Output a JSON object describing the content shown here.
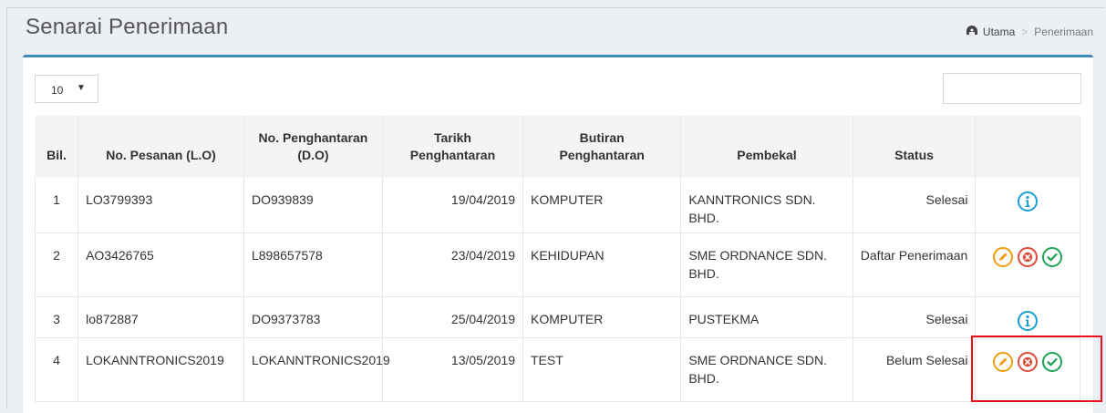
{
  "page": {
    "title": "Senarai Penerimaan"
  },
  "breadcrumb": {
    "home": "Utama",
    "current": "Penerimaan"
  },
  "controls": {
    "page_length": "10",
    "search_value": ""
  },
  "table": {
    "headers": {
      "bil": "Bil.",
      "pesanan": "No. Pesanan (L.O)",
      "penghantaran_1": "No. Penghantaran",
      "penghantaran_2": "(D.O)",
      "tarikh_1": "Tarikh",
      "tarikh_2": "Penghantaran",
      "butiran_1": "Butiran",
      "butiran_2": "Penghantaran",
      "pembekal": "Pembekal",
      "status": "Status"
    },
    "rows": [
      {
        "bil": "1",
        "lo": "LO3799393",
        "do": "DO939839",
        "tarikh": "19/04/2019",
        "butiran": "KOMPUTER",
        "pembekal": "KANNTRONICS SDN. BHD.",
        "status": "Selesai",
        "actions": [
          "info"
        ]
      },
      {
        "bil": "2",
        "lo": "AO3426765",
        "do": "L898657578",
        "tarikh": "23/04/2019",
        "butiran": "KEHIDUPAN",
        "pembekal": "SME ORDNANCE SDN. BHD.",
        "status": "Daftar Penerimaan",
        "actions": [
          "edit",
          "delete",
          "approve"
        ]
      },
      {
        "bil": "3",
        "lo": "lo872887",
        "do": "DO9373783",
        "tarikh": "25/04/2019",
        "butiran": "KOMPUTER",
        "pembekal": "PUSTEKMA",
        "status": "Selesai",
        "actions": [
          "info"
        ]
      },
      {
        "bil": "4",
        "lo": "LOKANNTRONICS2019",
        "do": "LOKANNTRONICS2019",
        "tarikh": "13/05/2019",
        "butiran": "TEST",
        "pembekal": "SME ORDNANCE SDN. BHD.",
        "status": "Belum Selesai",
        "actions": [
          "edit",
          "delete",
          "approve"
        ]
      }
    ]
  },
  "colors": {
    "accent": "#3c8dbc",
    "info": "#1aa0d0",
    "edit": "#f39c12",
    "delete": "#dd4b39",
    "approve": "#1fa355",
    "highlight": "#e8101a"
  }
}
